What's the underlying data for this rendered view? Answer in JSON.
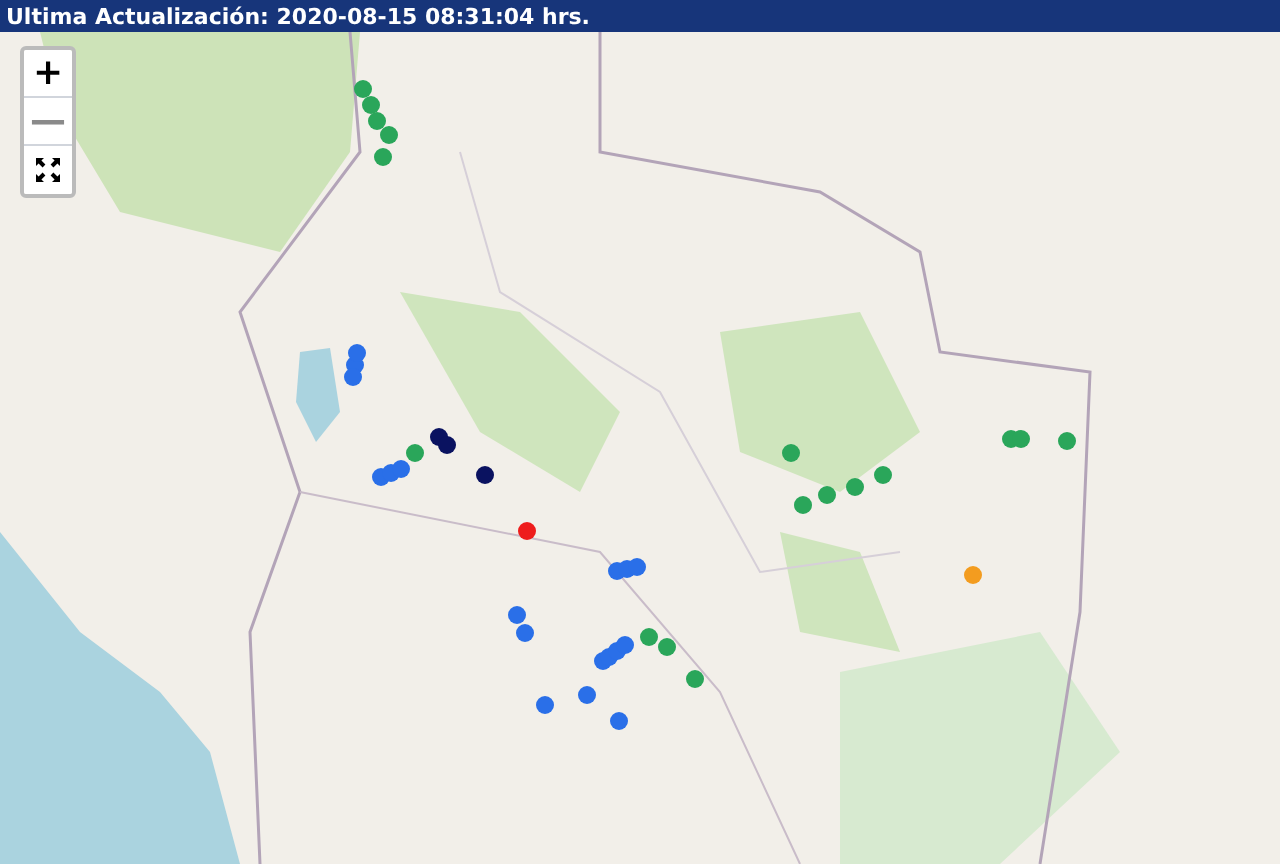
{
  "header": {
    "title": "Ultima Actualización: 2020-08-15 08:31:04 hrs."
  },
  "zoom_controls": [
    {
      "kind": "zoom_in",
      "label": "+",
      "disabled": false
    },
    {
      "kind": "zoom_out",
      "label": "—",
      "disabled": true
    },
    {
      "kind": "fullscreen",
      "disabled": false
    }
  ],
  "markers": [
    {
      "color": "#2aa65a"
    },
    {
      "color": "#2aa65a"
    },
    {
      "color": "#2aa65a"
    },
    {
      "color": "#2aa65a"
    },
    {
      "color": "#2aa65a"
    },
    {
      "color": "#2a6fe8"
    },
    {
      "color": "#2a6fe8"
    },
    {
      "color": "#2a6fe8"
    },
    {
      "color": "#2a6fe8"
    },
    {
      "color": "#2a6fe8"
    },
    {
      "color": "#2a6fe8"
    },
    {
      "color": "#0a1260"
    },
    {
      "color": "#0a1260"
    },
    {
      "color": "#0a1260"
    },
    {
      "color": "#2aa65a"
    },
    {
      "color": "#ee1c1c"
    },
    {
      "color": "#2a6fe8"
    },
    {
      "color": "#2a6fe8"
    },
    {
      "color": "#2a6fe8"
    },
    {
      "color": "#2a6fe8"
    },
    {
      "color": "#2a6fe8"
    },
    {
      "color": "#2aa65a"
    },
    {
      "color": "#2aa65a"
    },
    {
      "color": "#2aa65a"
    },
    {
      "color": "#2a6fe8"
    },
    {
      "color": "#2a6fe8"
    },
    {
      "color": "#2a6fe8"
    },
    {
      "color": "#2a6fe8"
    },
    {
      "color": "#2a6fe8"
    },
    {
      "color": "#2a6fe8"
    },
    {
      "color": "#2a6fe8"
    },
    {
      "color": "#2aa65a"
    },
    {
      "color": "#2aa65a"
    },
    {
      "color": "#2aa65a"
    },
    {
      "color": "#2aa65a"
    },
    {
      "color": "#2aa65a"
    },
    {
      "color": "#2aa65a"
    },
    {
      "color": "#2aa65a"
    },
    {
      "color": "#2aa65a"
    },
    {
      "color": "#f39c1f"
    }
  ]
}
